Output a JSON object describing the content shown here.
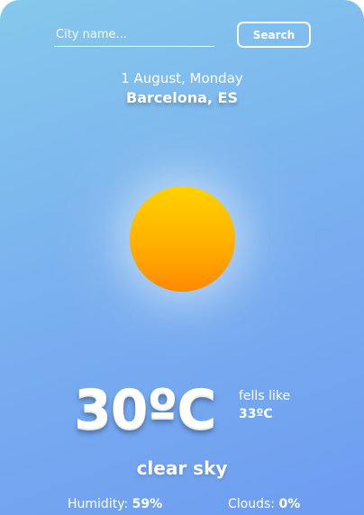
{
  "search": {
    "placeholder": "City name...",
    "button_label": "Search"
  },
  "date": "1 August, Monday",
  "location": "Barcelona, ES",
  "weather": {
    "icon": "sun-icon",
    "temperature": "30ºC",
    "feels_like_label": "fells like",
    "feels_like_value": "33ºC",
    "condition": "clear sky"
  },
  "stats": {
    "humidity_label": "Humidity:",
    "humidity_value": "59%",
    "clouds_label": "Clouds:",
    "clouds_value": "0%"
  },
  "colors": {
    "background_top": "#86c8ec",
    "background_bottom": "#6e9cf1",
    "sun_top": "#ffd200",
    "sun_bottom": "#ff8a00"
  }
}
